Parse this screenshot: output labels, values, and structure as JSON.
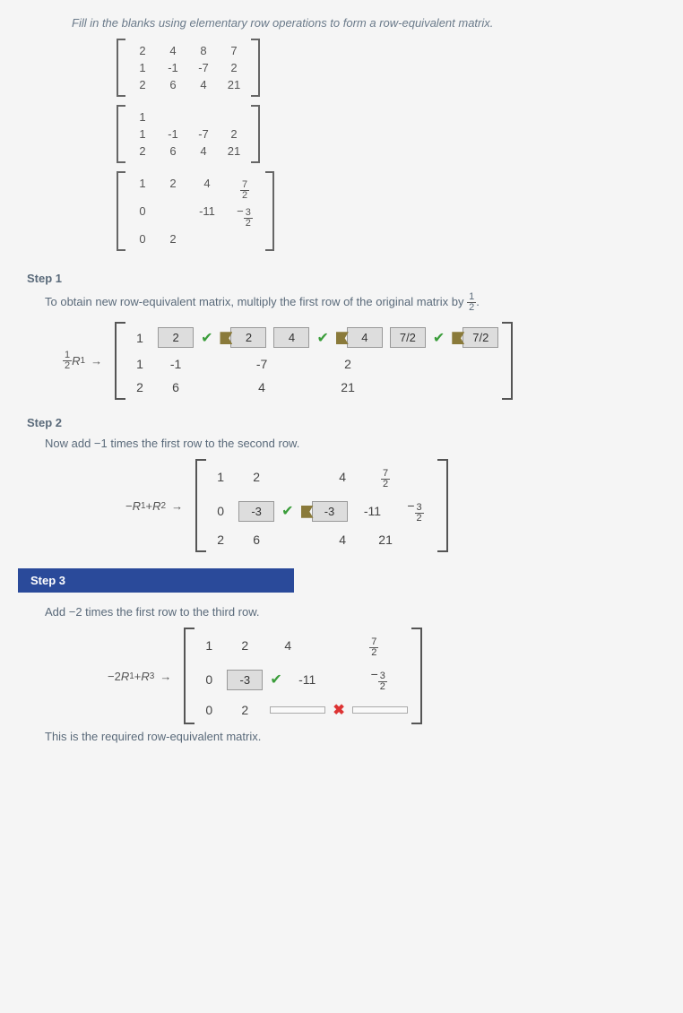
{
  "instr": "Fill in the blanks using elementary row operations to form a row-equivalent matrix.",
  "m1": [
    [
      "2",
      "4",
      "8",
      "7"
    ],
    [
      "1",
      "-1",
      "-7",
      "2"
    ],
    [
      "2",
      "6",
      "4",
      "21"
    ]
  ],
  "m2": [
    [
      "1",
      "",
      "",
      ""
    ],
    [
      "1",
      "-1",
      "-7",
      "2"
    ],
    [
      "2",
      "6",
      "4",
      "21"
    ]
  ],
  "m3": [
    [
      "1",
      "2",
      "4",
      "7/2"
    ],
    [
      "0",
      "",
      "-11",
      "-3/2"
    ],
    [
      "0",
      "2",
      "",
      ""
    ]
  ],
  "step1": {
    "h": "Step 1",
    "txt": "To obtain new row-equivalent matrix, multiply the first row of the original matrix by",
    "fr": [
      "1",
      "2"
    ],
    "op": "½R₁ →",
    "r1": {
      "c1": "1",
      "b1": "2",
      "b2": "2",
      "b3": "4",
      "b4": "4",
      "b5": "7/2",
      "b6": "7/2"
    },
    "r2": [
      "1",
      "-1",
      "-7",
      "2"
    ],
    "r3": [
      "2",
      "6",
      "4",
      "21"
    ]
  },
  "step2": {
    "h": "Step 2",
    "txt": "Now add −1 times the first row to the second row.",
    "op": "−R₁ + R₂ →",
    "r1": [
      "1",
      "2",
      "4",
      "7/2"
    ],
    "r2": {
      "c1": "0",
      "b1": "-3",
      "b2": "-3",
      "c3": "-11",
      "c4": "-3/2"
    },
    "r3": [
      "2",
      "6",
      "4",
      "21"
    ]
  },
  "step3": {
    "h": "Step 3",
    "txt": "Add −2 times the first row to the third row.",
    "op": "−2R₁ + R₃ →",
    "r1": [
      "1",
      "2",
      "4",
      "7/2"
    ],
    "r2": {
      "c1": "0",
      "b1": "-3",
      "c3": "-11",
      "c4": "-3/2"
    },
    "r3": {
      "c1": "0",
      "c2": "2"
    },
    "out": "This is the required row-equivalent matrix."
  }
}
